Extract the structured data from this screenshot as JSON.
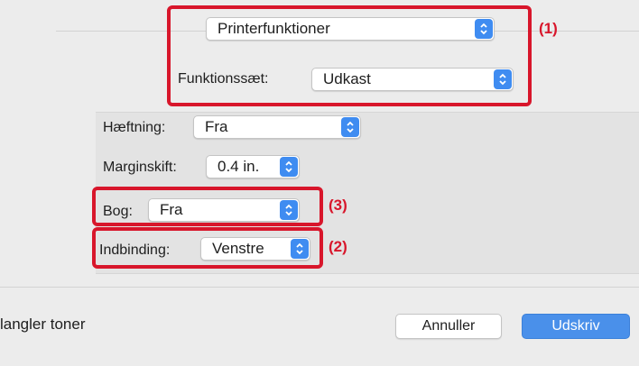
{
  "printer_features": {
    "panel_value": "Printerfunktioner"
  },
  "feature_set": {
    "label": "Funktionssæt:",
    "value": "Udkast"
  },
  "stapling": {
    "label": "Hæftning:",
    "value": "Fra"
  },
  "margin_shift": {
    "label": "Marginskift:",
    "value": "0.4 in."
  },
  "book": {
    "label": "Bog:",
    "value": "Fra"
  },
  "binding": {
    "label": "Indbinding:",
    "value": "Venstre"
  },
  "callouts": {
    "one": "(1)",
    "two": "(2)",
    "three": "(3)"
  },
  "footer": {
    "status": "langler toner",
    "cancel_label": "Annuller",
    "print_label": "Udskriv"
  },
  "colors": {
    "highlight": "#d8162b",
    "accent": "#3f8cf1",
    "print_button": "#4a90ea"
  }
}
